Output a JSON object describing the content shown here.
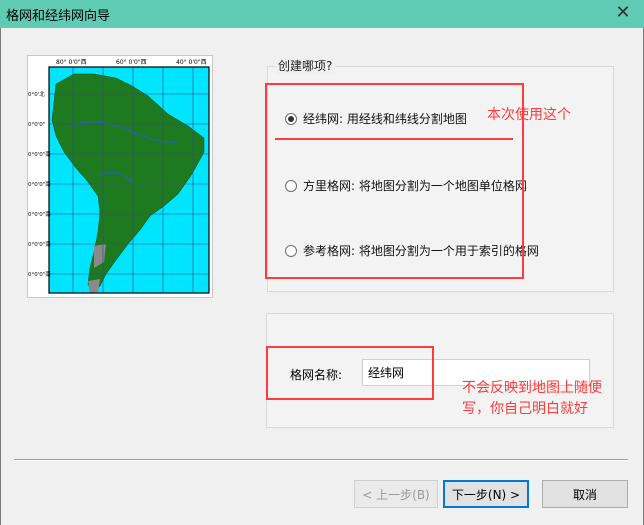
{
  "window": {
    "title": "格网和经纬网向导",
    "close_glyph": "✕"
  },
  "map": {
    "top_labels": [
      "80° 0'0\"西",
      "60° 0'0\"西",
      "40° 0'0\"西"
    ],
    "left_labels": [
      "0°0'北",
      "0°0'0\"",
      "0°0'0\"南",
      "0°0'0\"南",
      "0°0'0\"南",
      "0°0'0\"南",
      "0°0'0\"南"
    ],
    "colors": {
      "ocean": "#00e5ff",
      "land": "#1e7a1e",
      "grid": "#3a4a80",
      "frame": "#000000"
    }
  },
  "create": {
    "title": "创建哪项?",
    "options": [
      {
        "label": "经纬网: 用经线和纬线分割地图",
        "checked": true
      },
      {
        "label": "方里格网: 将地图分割为一个地图单位格网",
        "checked": false
      },
      {
        "label": "参考格网: 将地图分割为一个用于索引的格网",
        "checked": false
      }
    ]
  },
  "name": {
    "label": "格网名称:",
    "value": "经纬网"
  },
  "buttons": {
    "back": "< 上一步(B)",
    "next": "下一步(N) >",
    "cancel": "取消"
  },
  "annotations": {
    "note1": "本次使用这个",
    "note2_line1": "不会反映到地图上随便",
    "note2_line2": "写，你自己明白就好",
    "color": "#ff3b3b"
  }
}
